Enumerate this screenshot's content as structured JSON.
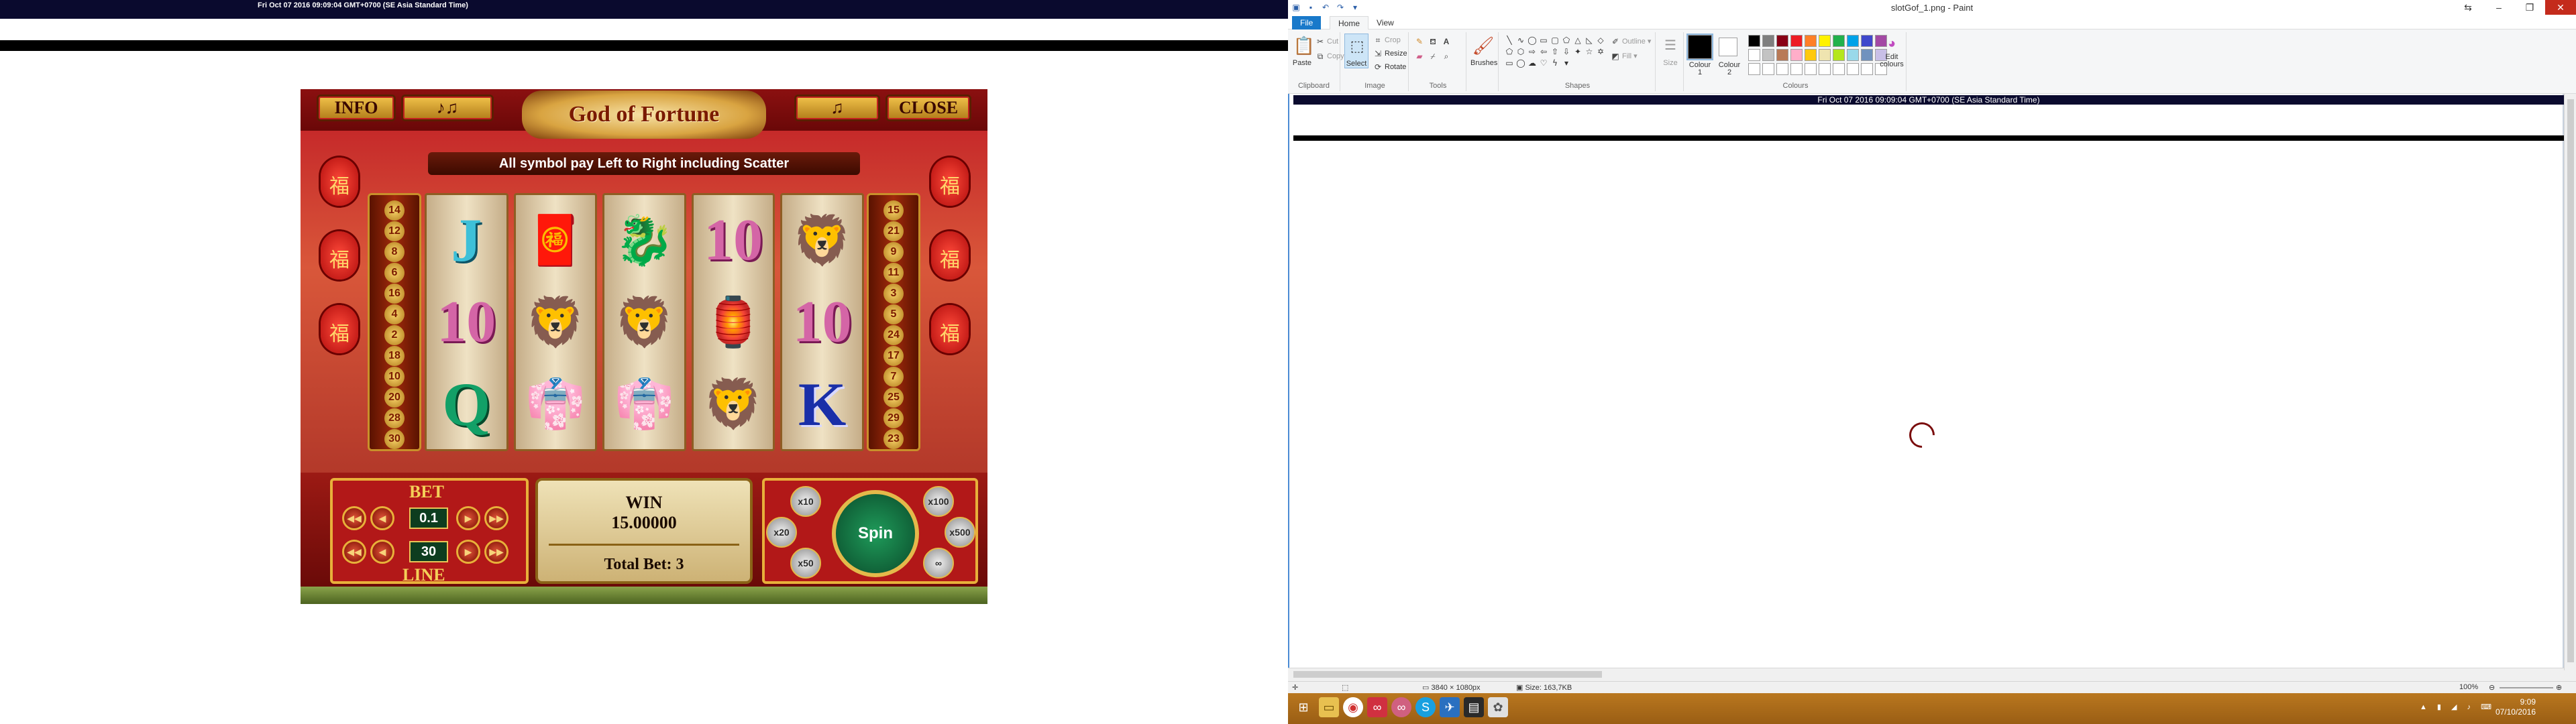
{
  "left_screen": {
    "timestamp": "Fri Oct 07 2016 09:09:04 GMT+0700 (SE Asia Standard Time)",
    "game": {
      "buttons": {
        "info": "INFO",
        "close": "CLOSE",
        "paytable": "♪♫",
        "sound": "♫"
      },
      "logo": "God of Fortune",
      "banner": "All symbol pay Left to Right including Scatter",
      "reels": [
        [
          {
            "label": "J",
            "kind": "j"
          },
          {
            "label": "10",
            "kind": "ten"
          },
          {
            "label": "Q",
            "kind": "q"
          }
        ],
        [
          {
            "label": "🧧",
            "kind": "pic"
          },
          {
            "label": "🦁",
            "kind": "pic"
          },
          {
            "label": "👘",
            "kind": "pic"
          }
        ],
        [
          {
            "label": "🐉",
            "kind": "pic"
          },
          {
            "label": "🦁",
            "kind": "pic"
          },
          {
            "label": "👘",
            "kind": "pic"
          }
        ],
        [
          {
            "label": "10",
            "kind": "ten"
          },
          {
            "label": "🏮",
            "kind": "pic"
          },
          {
            "label": "🦁",
            "kind": "pic"
          }
        ],
        [
          {
            "label": "🦁",
            "kind": "pic"
          },
          {
            "label": "10",
            "kind": "ten"
          },
          {
            "label": "K",
            "kind": "k"
          }
        ]
      ],
      "left_pillar_numbers": [
        "14",
        "12",
        "8",
        "6",
        "16",
        "4",
        "2",
        "18",
        "10",
        "20",
        "28",
        "30"
      ],
      "right_pillar_numbers": [
        "15",
        "21",
        "9",
        "11",
        "3",
        "5",
        "24",
        "17",
        "7",
        "25",
        "29",
        "23"
      ],
      "bet_label": "BET",
      "bet_value": "0.1",
      "line_label": "LINE",
      "line_value": "30",
      "win_label": "WIN",
      "win_value": "15.00000",
      "total_bet_label": "Total Bet: 3",
      "spin_label": "Spin",
      "autoplay": [
        "x10",
        "x100",
        "x20",
        "x500",
        "x50",
        "∞"
      ]
    }
  },
  "paint": {
    "window_title": "slotGof_1.png - Paint",
    "tabs": {
      "file": "File",
      "home": "Home",
      "view": "View"
    },
    "clipboard": {
      "paste": "Paste",
      "cut": "Cut",
      "copy": "Copy",
      "group": "Clipboard"
    },
    "image": {
      "select": "Select",
      "crop": "Crop",
      "resize": "Resize",
      "rotate": "Rotate",
      "group": "Image"
    },
    "tools_group": "Tools",
    "brushes": "Brushes",
    "shapes": {
      "outline": "Outline",
      "fill": "Fill",
      "group": "Shapes"
    },
    "size": "Size",
    "colour1": "Colour 1",
    "colour2": "Colour 2",
    "edit_colours": "Edit colours",
    "colours_group": "Colours",
    "palette": [
      "#000000",
      "#7f7f7f",
      "#880015",
      "#ed1c24",
      "#ff7f27",
      "#fff200",
      "#22b14c",
      "#00a2e8",
      "#3f48cc",
      "#a349a4",
      "#ffffff",
      "#c3c3c3",
      "#b97a57",
      "#ffaec9",
      "#ffc90e",
      "#efe4b0",
      "#b5e61d",
      "#99d9ea",
      "#7092be",
      "#c8bfe7"
    ],
    "canvas_timestamp": "Fri Oct 07 2016 09:09:04 GMT+0700 (SE Asia Standard Time)",
    "status": {
      "dimensions": "3840 × 1080px",
      "size": "Size: 163,7KB",
      "zoom": "100%"
    },
    "taskbar": {
      "time": "9:09",
      "date": "07/10/2016"
    }
  }
}
